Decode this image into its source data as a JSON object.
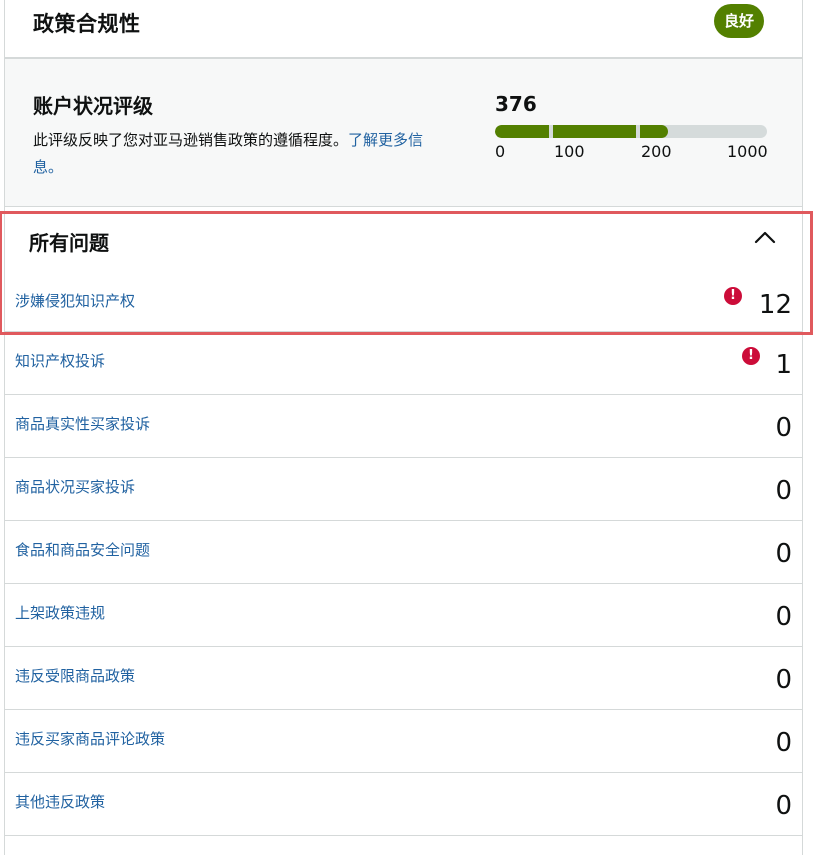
{
  "header": {
    "title": "政策合规性",
    "status": "良好",
    "status_color": "#538000"
  },
  "rating": {
    "title": "账户状况评级",
    "description": "此评级反映了您对亚马逊销售政策的遵循程度。",
    "learn_more": "了解更多信息。",
    "score": "376",
    "scale_fill_fraction": 0.376,
    "ticks": [
      "0",
      "100",
      "200",
      "1000"
    ]
  },
  "issues": {
    "title": "所有问题",
    "items": [
      {
        "label": "涉嫌侵犯知识产权",
        "count": "12",
        "alert": true
      },
      {
        "label": "知识产权投诉",
        "count": "1",
        "alert": true
      },
      {
        "label": "商品真实性买家投诉",
        "count": "0",
        "alert": false
      },
      {
        "label": "商品状况买家投诉",
        "count": "0",
        "alert": false
      },
      {
        "label": "食品和商品安全问题",
        "count": "0",
        "alert": false
      },
      {
        "label": "上架政策违规",
        "count": "0",
        "alert": false
      },
      {
        "label": "违反受限商品政策",
        "count": "0",
        "alert": false
      },
      {
        "label": "违反买家商品评论政策",
        "count": "0",
        "alert": false
      },
      {
        "label": "其他违反政策",
        "count": "0",
        "alert": false
      }
    ]
  },
  "colors": {
    "link": "#2162a1",
    "alert": "#cc0c39",
    "highlight": "#e0595d"
  }
}
